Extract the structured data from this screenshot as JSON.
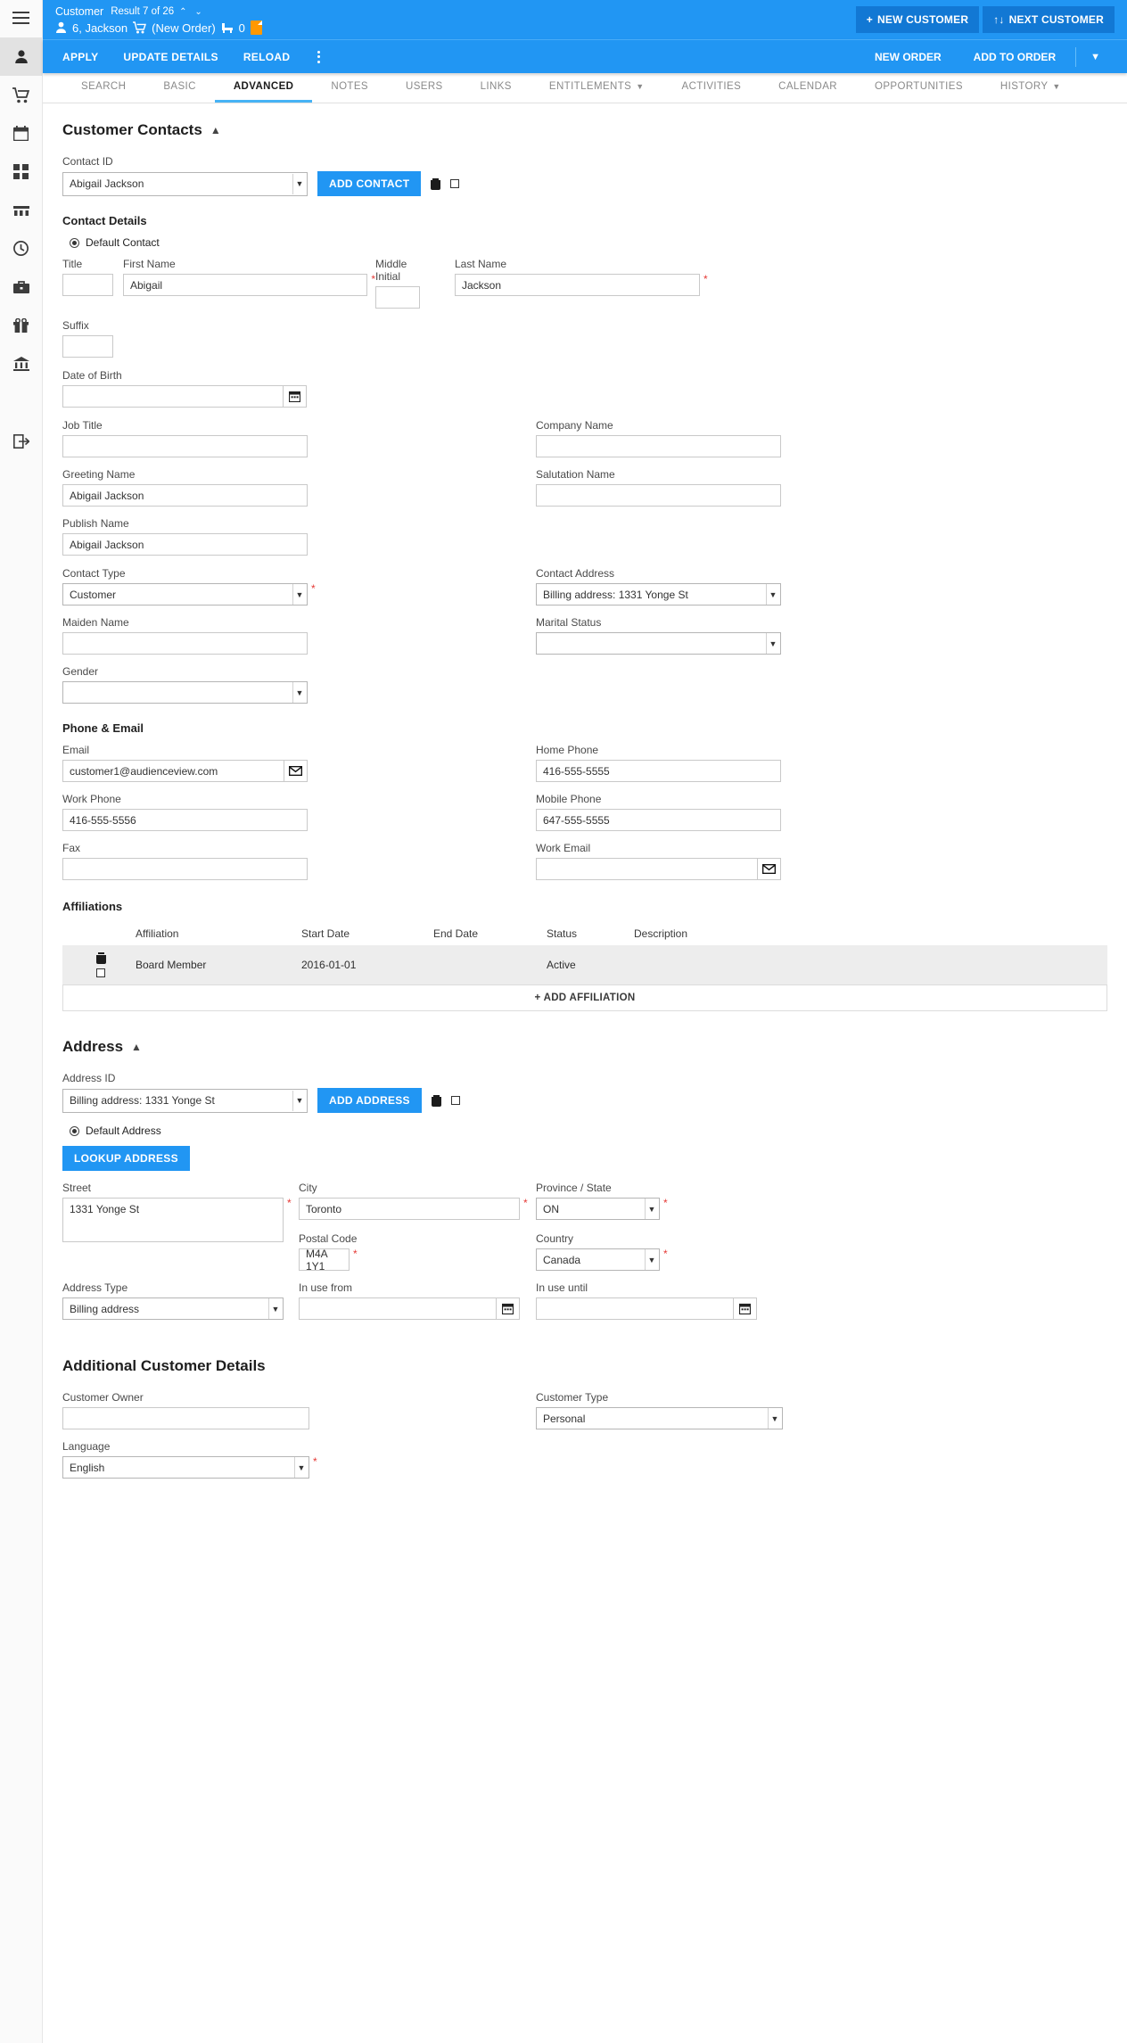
{
  "sidebar": {
    "items": [
      {
        "name": "menu",
        "icon": "hamburger-icon"
      },
      {
        "name": "customer",
        "icon": "person-icon",
        "active": true
      },
      {
        "name": "orders",
        "icon": "cart-icon"
      },
      {
        "name": "calendar",
        "icon": "calendar-icon"
      },
      {
        "name": "dashboard",
        "icon": "grid-icon"
      },
      {
        "name": "venue",
        "icon": "seating-icon"
      },
      {
        "name": "history",
        "icon": "clock-icon"
      },
      {
        "name": "box-office",
        "icon": "briefcase-icon"
      },
      {
        "name": "gifts",
        "icon": "gift-icon"
      },
      {
        "name": "reports",
        "icon": "bank-icon"
      },
      {
        "name": "logout",
        "icon": "exit-icon"
      }
    ]
  },
  "header": {
    "entity_label": "Customer",
    "result_text": "Result 7 of 26",
    "customer_name": "6, Jackson",
    "order_status": "(New Order)",
    "seat_count": "0",
    "new_customer_label": "NEW CUSTOMER",
    "new_customer_prefix": "+",
    "next_customer_label": "NEXT CUSTOMER",
    "next_customer_prefix": "↑↓",
    "accent": "#2196f3",
    "button_bg": "#1278d4"
  },
  "actionbar": {
    "left": [
      "APPLY",
      "UPDATE DETAILS",
      "RELOAD"
    ],
    "right": [
      "NEW ORDER",
      "ADD TO ORDER"
    ],
    "overflow_icon": "kebab-menu-icon",
    "chevron_icon": "chevron-down-icon"
  },
  "tabs": [
    {
      "label": "SEARCH",
      "active": false,
      "caret": false
    },
    {
      "label": "BASIC",
      "active": false,
      "caret": false
    },
    {
      "label": "ADVANCED",
      "active": true,
      "caret": false
    },
    {
      "label": "NOTES",
      "active": false,
      "caret": false
    },
    {
      "label": "USERS",
      "active": false,
      "caret": false
    },
    {
      "label": "LINKS",
      "active": false,
      "caret": false
    },
    {
      "label": "ENTITLEMENTS",
      "active": false,
      "caret": true
    },
    {
      "label": "ACTIVITIES",
      "active": false,
      "caret": false
    },
    {
      "label": "CALENDAR",
      "active": false,
      "caret": false
    },
    {
      "label": "OPPORTUNITIES",
      "active": false,
      "caret": false
    },
    {
      "label": "HISTORY",
      "active": false,
      "caret": true
    }
  ],
  "customer_contacts": {
    "title": "Customer Contacts",
    "contact_id_label": "Contact ID",
    "contact_id_value": "Abigail Jackson",
    "add_contact_label": "ADD CONTACT",
    "contact_details_label": "Contact Details",
    "default_contact_label": "Default Contact",
    "fields": {
      "title_label": "Title",
      "title_value": "",
      "first_name_label": "First Name",
      "first_name_value": "Abigail",
      "middle_initial_label": "Middle Initial",
      "middle_initial_value": "",
      "last_name_label": "Last Name",
      "last_name_value": "Jackson",
      "suffix_label": "Suffix",
      "suffix_value": "",
      "dob_label": "Date of Birth",
      "dob_value": "",
      "job_title_label": "Job Title",
      "job_title_value": "",
      "company_name_label": "Company Name",
      "company_name_value": "",
      "greeting_name_label": "Greeting Name",
      "greeting_name_value": "Abigail Jackson",
      "salutation_name_label": "Salutation Name",
      "salutation_name_value": "",
      "publish_name_label": "Publish Name",
      "publish_name_value": "Abigail Jackson",
      "contact_type_label": "Contact Type",
      "contact_type_value": "Customer",
      "contact_address_label": "Contact Address",
      "contact_address_value": "Billing address: 1331 Yonge St",
      "maiden_name_label": "Maiden Name",
      "maiden_name_value": "",
      "marital_status_label": "Marital Status",
      "marital_status_value": "",
      "gender_label": "Gender",
      "gender_value": ""
    },
    "phone_email": {
      "title": "Phone & Email",
      "email_label": "Email",
      "email_value": "customer1@audienceview.com",
      "home_phone_label": "Home Phone",
      "home_phone_value": "416-555-5555",
      "work_phone_label": "Work Phone",
      "work_phone_value": "416-555-5556",
      "mobile_phone_label": "Mobile Phone",
      "mobile_phone_value": "647-555-5555",
      "fax_label": "Fax",
      "fax_value": "",
      "work_email_label": "Work Email",
      "work_email_value": ""
    },
    "affiliations": {
      "title": "Affiliations",
      "columns": [
        "Affiliation",
        "Start Date",
        "End Date",
        "Status",
        "Description"
      ],
      "rows": [
        {
          "affiliation": "Board Member",
          "start_date": "2016-01-01",
          "end_date": "",
          "status": "Active",
          "description": ""
        }
      ],
      "add_label": "+ ADD AFFILIATION"
    }
  },
  "address": {
    "title": "Address",
    "address_id_label": "Address ID",
    "address_id_value": "Billing address: 1331 Yonge St",
    "add_address_label": "ADD ADDRESS",
    "default_address_label": "Default Address",
    "lookup_address_label": "LOOKUP ADDRESS",
    "street_label": "Street",
    "street_value": "1331 Yonge St",
    "city_label": "City",
    "city_value": "Toronto",
    "province_label": "Province / State",
    "province_value": "ON",
    "postal_code_label": "Postal Code",
    "postal_code_value": "M4A 1Y1",
    "country_label": "Country",
    "country_value": "Canada",
    "address_type_label": "Address Type",
    "address_type_value": "Billing address",
    "in_use_from_label": "In use from",
    "in_use_from_value": "",
    "in_use_until_label": "In use until",
    "in_use_until_value": ""
  },
  "additional": {
    "title": "Additional Customer Details",
    "customer_owner_label": "Customer Owner",
    "customer_owner_value": "",
    "customer_type_label": "Customer Type",
    "customer_type_value": "Personal",
    "language_label": "Language",
    "language_value": "English"
  }
}
